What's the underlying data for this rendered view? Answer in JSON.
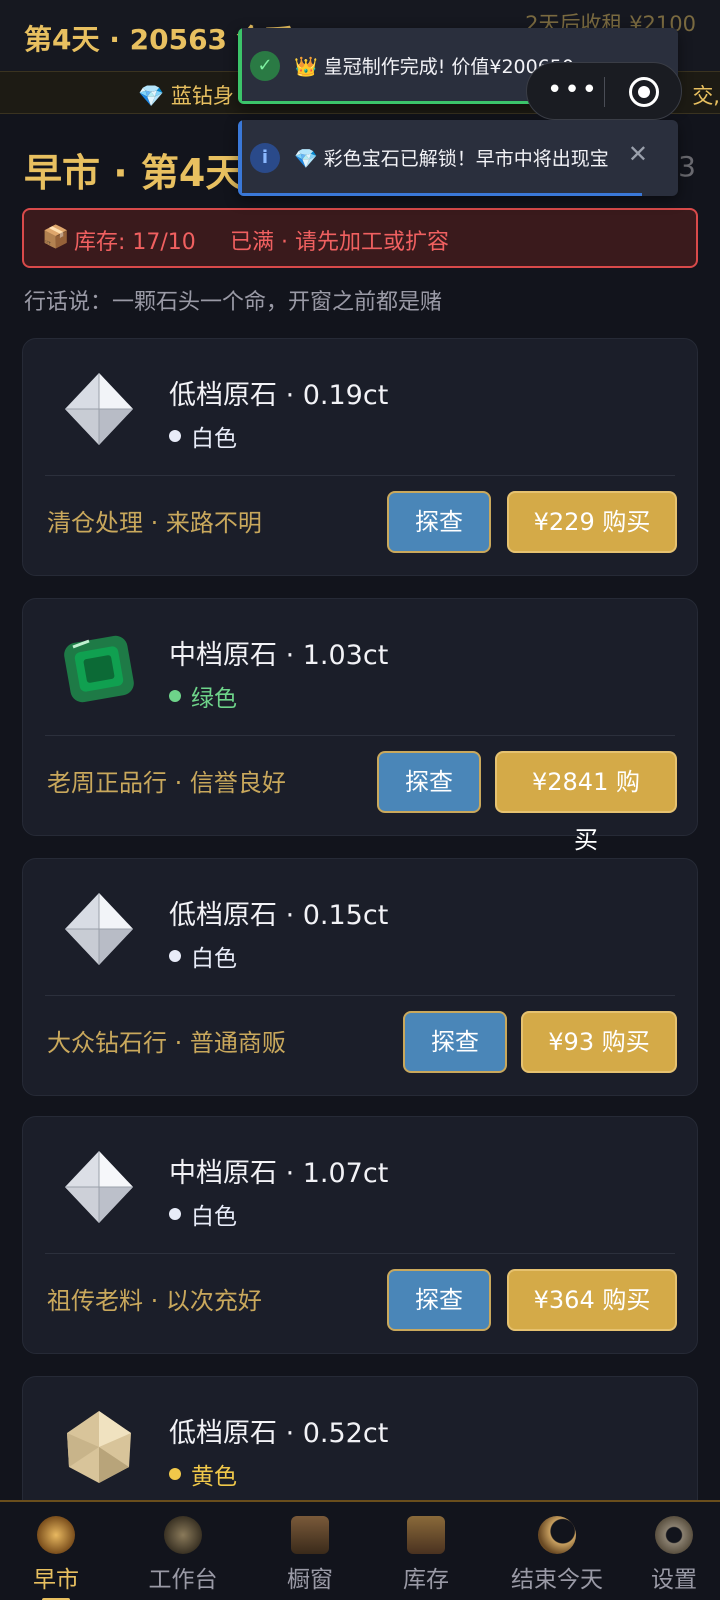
{
  "topbar": {
    "day_coins": "第4天 · 20563 金币",
    "rent_notice": "2天后收租 ¥2100"
  },
  "ticker": {
    "left_text": "💎 蓝钻身",
    "right_text": "交,"
  },
  "toasts": [
    {
      "message": "👑 皇冠制作完成! 价值¥200650",
      "type": "success",
      "icon": "check-icon",
      "color": "#3cc46a"
    },
    {
      "message": "💎 彩色宝石已解锁！早市中将出现宝",
      "type": "info",
      "icon": "info-icon",
      "color": "#3a78d8"
    }
  ],
  "header": {
    "title": "早市 · 第4天",
    "right_fragment": "3"
  },
  "stock_warning": {
    "icon": "box-icon",
    "label": "库存: 17/10",
    "status": "已满 · 请先加工或扩容"
  },
  "quote": "行话说：一颗石头一个命，开窗之前都是赌",
  "market_items": [
    {
      "name": "低档原石 · 0.19ct",
      "color_name": "白色",
      "color_hex": "#e8ecf8",
      "seller": "清仓处理 · 来路不明",
      "probe_label": "探查",
      "buy_label": "¥229 购买",
      "gem_icon": "white-diamond-icon"
    },
    {
      "name": "中档原石 · 1.03ct",
      "color_name": "绿色",
      "color_hex": "#6ed48a",
      "seller": "老周正品行 · 信誉良好",
      "probe_label": "探查",
      "buy_label": "¥2841 购买",
      "gem_icon": "emerald-icon"
    },
    {
      "name": "低档原石 · 0.15ct",
      "color_name": "白色",
      "color_hex": "#e8ecf8",
      "seller": "大众钻石行 · 普通商贩",
      "probe_label": "探查",
      "buy_label": "¥93 购买",
      "gem_icon": "white-diamond-icon"
    },
    {
      "name": "中档原石 · 1.07ct",
      "color_name": "白色",
      "color_hex": "#e8ecf8",
      "seller": "祖传老料 · 以次充好",
      "probe_label": "探查",
      "buy_label": "¥364 购买",
      "gem_icon": "white-diamond-icon"
    },
    {
      "name": "低档原石 · 0.52ct",
      "color_name": "黄色",
      "color_hex": "#f0c84a",
      "seller": "",
      "probe_label": "",
      "buy_label": "",
      "gem_icon": "yellow-diamond-icon"
    }
  ],
  "nav": {
    "items": [
      {
        "label": "早市",
        "icon": "market-icon",
        "active": true
      },
      {
        "label": "工作台",
        "icon": "workbench-icon",
        "active": false
      },
      {
        "label": "橱窗",
        "icon": "showcase-icon",
        "active": false
      },
      {
        "label": "库存",
        "icon": "chest-icon",
        "active": false
      },
      {
        "label": "结束今天",
        "icon": "moon-icon",
        "active": false
      },
      {
        "label": "设置",
        "icon": "gear-icon",
        "active": false
      }
    ]
  },
  "colors": {
    "gold": "#e8c060",
    "probe_button": "#4a86b8",
    "buy_button": "#d4aa48",
    "warning_red": "#f06060"
  }
}
